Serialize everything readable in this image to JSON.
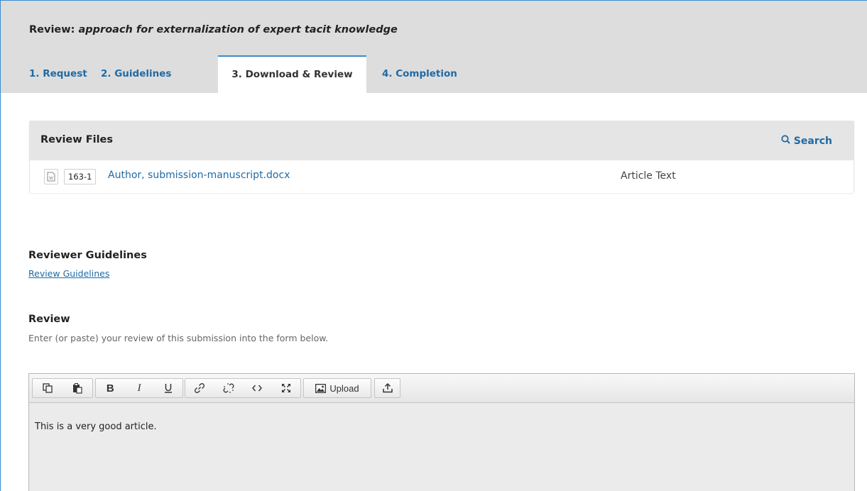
{
  "review": {
    "title_prefix": "Review:",
    "title_italic": "approach for externalization of expert tacit knowledge"
  },
  "tabs": [
    {
      "label": "1. Request",
      "active": false
    },
    {
      "label": "2. Guidelines",
      "active": false
    },
    {
      "label": "3. Download & Review",
      "active": true
    },
    {
      "label": "4. Completion",
      "active": false
    }
  ],
  "review_files": {
    "title": "Review Files",
    "search_label": "Search",
    "search_icon": "search-icon",
    "files": [
      {
        "icon": "word-document-icon",
        "id": "163-1",
        "name": "Author, submission-manuscript.docx",
        "type": "Article Text"
      }
    ]
  },
  "reviewer_guidelines": {
    "heading": "Reviewer Guidelines",
    "link": "Review Guidelines"
  },
  "review_form": {
    "heading": "Review",
    "description": "Enter (or paste) your review of this submission into the form below.",
    "toolbar": {
      "buttons": [
        "copy-icon",
        "paste-icon",
        "bold-icon",
        "italic-icon",
        "underline-icon",
        "link-icon",
        "unlink-icon",
        "code-icon",
        "fullscreen-icon",
        "image-icon",
        "upload-icon"
      ],
      "upload_label": "Upload"
    },
    "content": "This is a very good article."
  },
  "colors": {
    "accent": "#1f6aa5",
    "tab_border": "#3b8bd0",
    "header_bg": "#dddddd"
  }
}
